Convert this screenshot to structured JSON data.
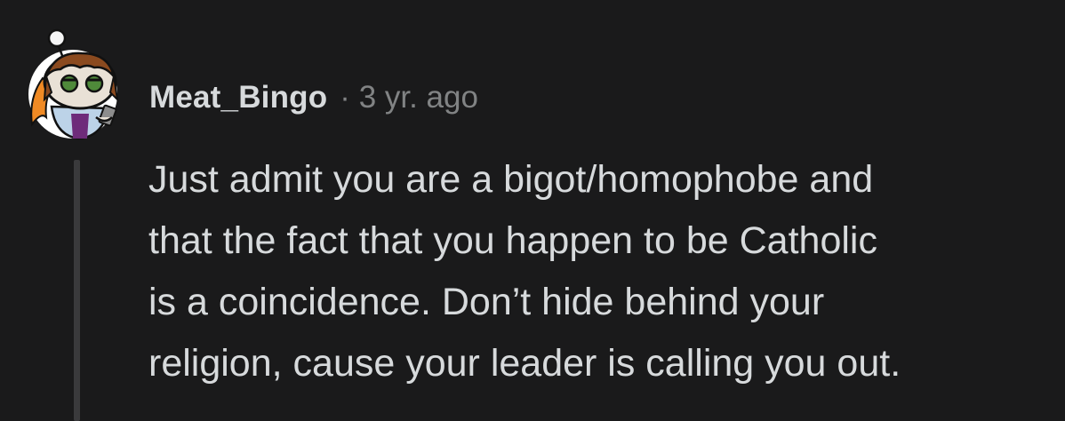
{
  "comment": {
    "author": "Meat_Bingo",
    "separator": "·",
    "timestamp": "3 yr. ago",
    "avatar_icon": "snoo-avatar-icon",
    "body_lines": [
      "Just admit you are a bigot/homophobe and",
      "that the fact that you happen to be Catholic",
      "is a coincidence. Don’t hide behind your",
      "religion, cause your leader is calling you out."
    ]
  },
  "colors": {
    "background": "#1a1a1b",
    "text_primary": "#d7dadc",
    "text_secondary": "#818384",
    "thread_line": "#3a3a3c"
  }
}
